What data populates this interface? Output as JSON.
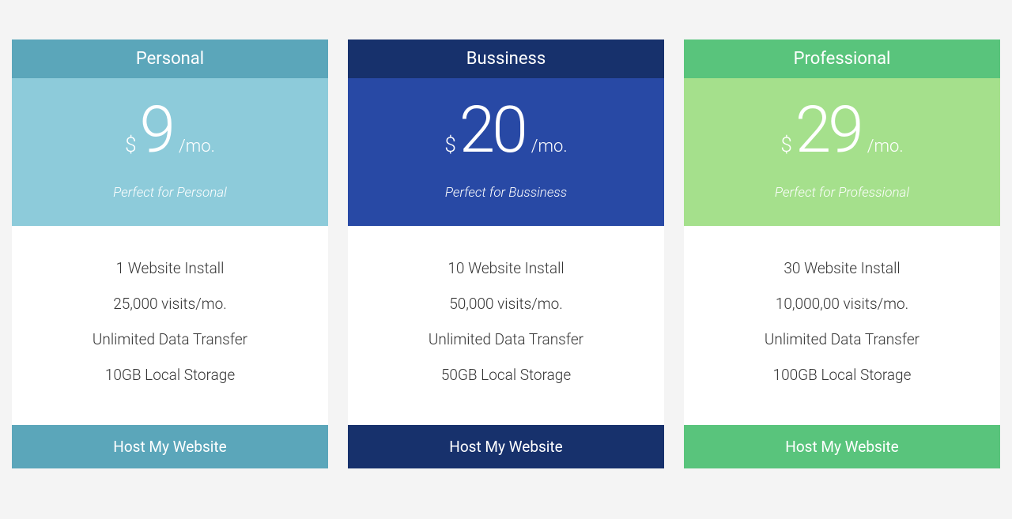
{
  "plans": [
    {
      "id": "personal",
      "title": "Personal",
      "currency": "$",
      "price": "9",
      "period": "/mo.",
      "subtitle": "Perfect for Personal",
      "features": [
        "1 Website Install",
        "25,000 visits/mo.",
        "Unlimited Data Transfer",
        "10GB Local Storage"
      ],
      "cta_label": "Host My Website"
    },
    {
      "id": "business",
      "title": "Bussiness",
      "currency": "$",
      "price": "20",
      "period": "/mo.",
      "subtitle": "Perfect for Bussiness",
      "features": [
        "10 Website Install",
        "50,000 visits/mo.",
        "Unlimited Data Transfer",
        "50GB Local Storage"
      ],
      "cta_label": "Host My Website"
    },
    {
      "id": "professional",
      "title": "Professional",
      "currency": "$",
      "price": "29",
      "period": "/mo.",
      "subtitle": "Perfect for Professional",
      "features": [
        "30 Website Install",
        "10,000,00 visits/mo.",
        "Unlimited Data Transfer",
        "100GB Local Storage"
      ],
      "cta_label": "Host My Website"
    }
  ]
}
